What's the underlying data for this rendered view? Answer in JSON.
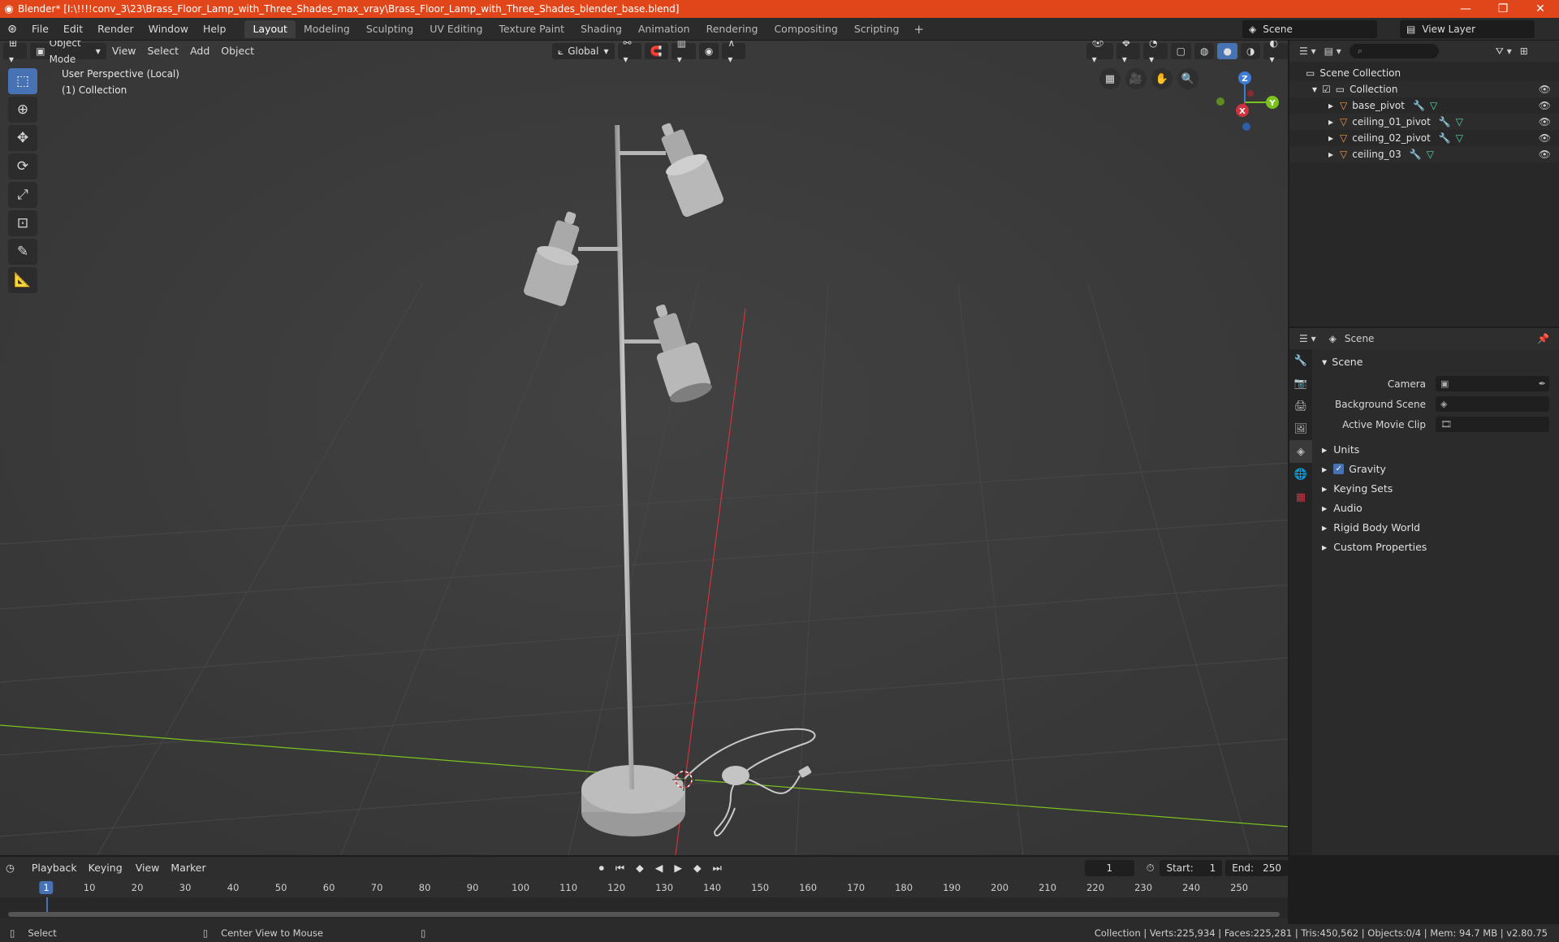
{
  "titlebar": {
    "title": "Blender* [I:\\!!!!conv_3\\23\\Brass_Floor_Lamp_with_Three_Shades_max_vray\\Brass_Floor_Lamp_with_Three_Shades_blender_base.blend]",
    "minimize": "—",
    "maximize": "❐",
    "close": "✕"
  },
  "menu": {
    "file": "File",
    "edit": "Edit",
    "render": "Render",
    "window": "Window",
    "help": "Help"
  },
  "workspaces": [
    "Layout",
    "Modeling",
    "Sculpting",
    "UV Editing",
    "Texture Paint",
    "Shading",
    "Animation",
    "Rendering",
    "Compositing",
    "Scripting"
  ],
  "workspace_add": "+",
  "scene_name": "Scene",
  "view_layer": "View Layer",
  "viewport": {
    "mode": "Object Mode",
    "menus": {
      "view": "View",
      "select": "Select",
      "add": "Add",
      "object": "Object"
    },
    "transform": "Global",
    "info_line1": "User Perspective (Local)",
    "info_line2": "(1) Collection",
    "gizmo": {
      "x": "X",
      "y": "Y",
      "z": "Z"
    }
  },
  "outliner": {
    "search_placeholder": "",
    "scene_collection": "Scene Collection",
    "collection": "Collection",
    "objects": [
      {
        "name": "base_pivot"
      },
      {
        "name": "ceiling_01_pivot"
      },
      {
        "name": "ceiling_02_pivot"
      },
      {
        "name": "ceiling_03"
      }
    ]
  },
  "properties": {
    "header": "Scene",
    "panel": "Scene",
    "camera_label": "Camera",
    "background_scene_label": "Background Scene",
    "active_movie_clip_label": "Active Movie Clip",
    "subpanels": {
      "units": "Units",
      "gravity": "Gravity",
      "keying_sets": "Keying Sets",
      "audio": "Audio",
      "rigid_body": "Rigid Body World",
      "custom_props": "Custom Properties"
    }
  },
  "timeline": {
    "menus": {
      "playback": "Playback",
      "keying": "Keying",
      "view": "View",
      "marker": "Marker"
    },
    "current_frame": "1",
    "start_label": "Start:",
    "start": "1",
    "end_label": "End:",
    "end": "250",
    "ticks": [
      "1",
      "10",
      "20",
      "30",
      "40",
      "50",
      "60",
      "70",
      "80",
      "90",
      "100",
      "110",
      "120",
      "130",
      "140",
      "150",
      "160",
      "170",
      "180",
      "190",
      "200",
      "210",
      "220",
      "230",
      "240",
      "250"
    ]
  },
  "status": {
    "select": "Select",
    "center_view": "Center View to Mouse",
    "stats": "Collection | Verts:225,934 | Faces:225,281 | Tris:450,562 | Objects:0/4 | Mem: 94.7 MB | v2.80.75"
  },
  "colors": {
    "title_bar": "#e1461a",
    "accent": "#4772b3",
    "x_axis": "#d0333e",
    "y_axis": "#7ac31e",
    "z_axis": "#3e7dd6"
  }
}
